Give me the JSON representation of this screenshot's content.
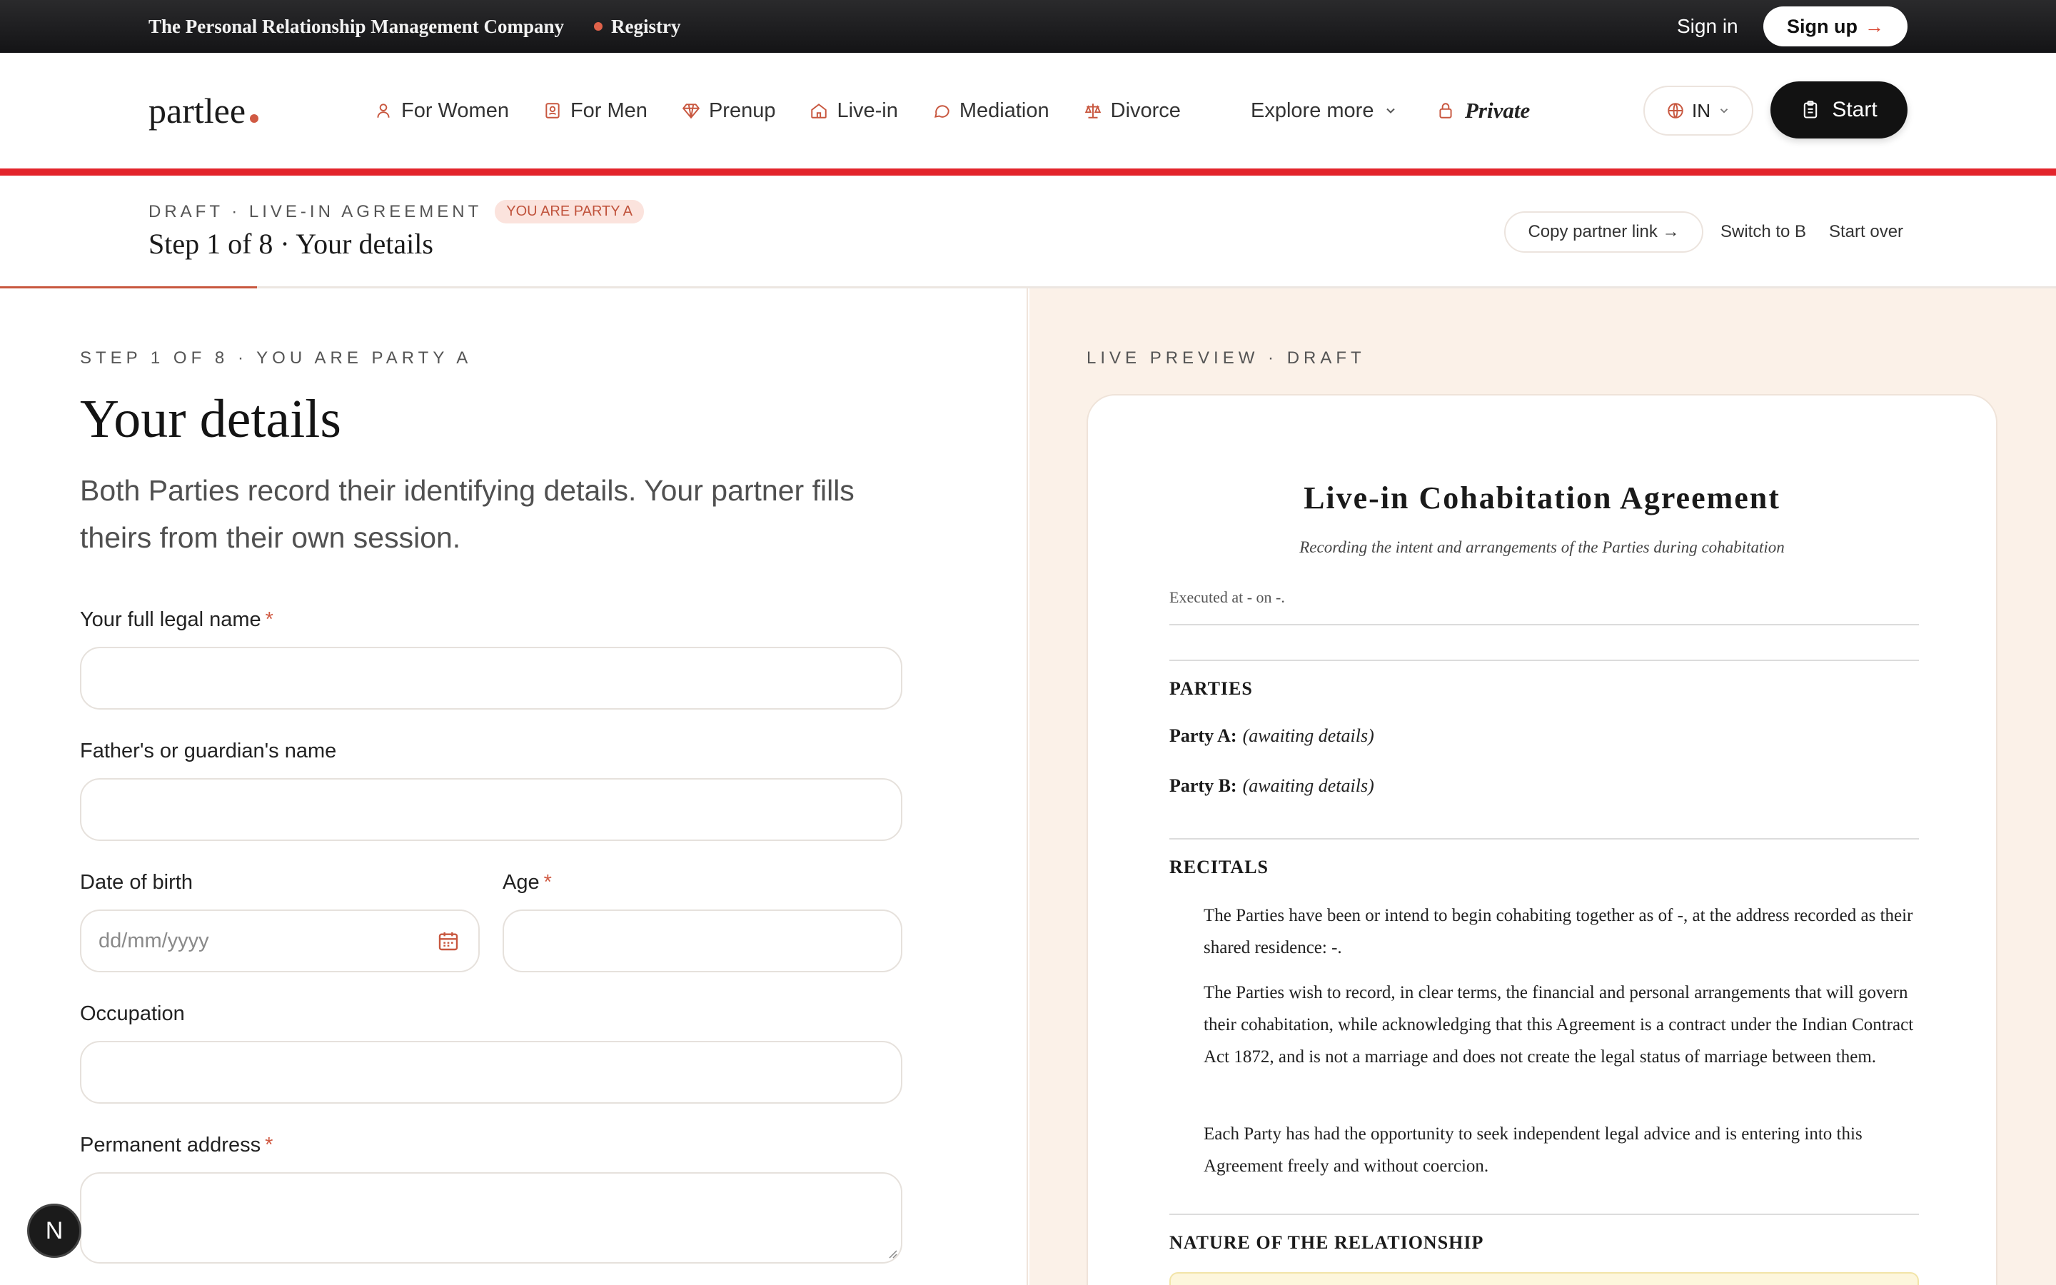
{
  "topbar": {
    "tagline": "The Personal Relationship Management Company",
    "registry": "Registry",
    "sign_in": "Sign in",
    "sign_up": "Sign up",
    "sign_up_arrow": "→"
  },
  "brand": {
    "logo": "partlee",
    "accent": "#d05a43"
  },
  "nav": {
    "items": [
      {
        "label": "For Women",
        "icon": "person-icon"
      },
      {
        "label": "For Men",
        "icon": "id-badge-icon"
      },
      {
        "label": "Prenup",
        "icon": "diamond-icon"
      },
      {
        "label": "Live-in",
        "icon": "home-icon"
      },
      {
        "label": "Mediation",
        "icon": "chat-bubble-icon"
      },
      {
        "label": "Divorce",
        "icon": "scales-icon"
      }
    ],
    "explore_more": "Explore more",
    "private": "Private",
    "language": "IN",
    "start": "Start"
  },
  "draft_header": {
    "eyebrow": "DRAFT · LIVE-IN AGREEMENT",
    "badge": "YOU ARE PARTY A",
    "title": "Step 1 of 8 · Your details",
    "copy_link": "Copy partner link →",
    "switch": "Switch to B",
    "start_over": "Start over",
    "progress": 0.125
  },
  "form": {
    "eyebrow": "STEP 1 OF 8 · YOU ARE PARTY A",
    "heading": "Your details",
    "lede": "Both Parties record their identifying details. Your partner fills theirs from their own session.",
    "fields": {
      "full_name": {
        "label": "Your full legal name",
        "required": true,
        "value": ""
      },
      "guardian": {
        "label": "Father's or guardian's name",
        "required": false,
        "value": ""
      },
      "dob": {
        "label": "Date of birth",
        "required": false,
        "placeholder": "dd/mm/yyyy",
        "value": ""
      },
      "age": {
        "label": "Age",
        "required": true,
        "value": ""
      },
      "occupation": {
        "label": "Occupation",
        "required": false,
        "value": ""
      },
      "address": {
        "label": "Permanent address",
        "required": true,
        "value": ""
      }
    },
    "required_mark": "*"
  },
  "preview": {
    "eyebrow": "LIVE PREVIEW · DRAFT",
    "title": "Live-in Cohabitation Agreement",
    "subtitle": "Recording the intent and arrangements of the Parties during cohabitation",
    "executed": "Executed at - on -.",
    "parties_heading": "PARTIES",
    "party_a_label": "Party A:",
    "party_a_value": "(awaiting details)",
    "party_b_label": "Party B:",
    "party_b_value": "(awaiting details)",
    "recitals_heading": "RECITALS",
    "recitals": [
      "The Parties have been or intend to begin cohabiting together as of -, at the address recorded as their shared residence: -.",
      "The Parties wish to record, in clear terms, the financial and personal arrangements that will govern their cohabitation, while acknowledging that this Agreement is a contract under the Indian Contract Act 1872, and is not a marriage and does not create the legal status of marriage between them.",
      "Each Party has had the opportunity to seek independent legal advice and is entering into this Agreement freely and without coercion."
    ],
    "nature_heading": "NATURE OF THE RELATIONSHIP"
  },
  "floating_badge": "N"
}
